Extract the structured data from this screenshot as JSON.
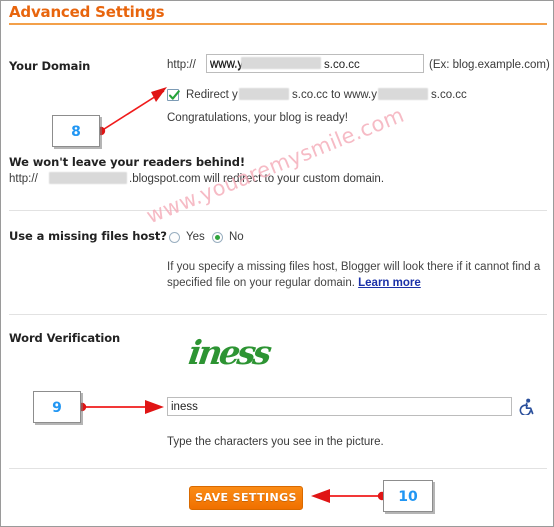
{
  "header": {
    "title": "Advanced Settings"
  },
  "domain": {
    "label": "Your Domain",
    "protocol_prefix": "http://",
    "input_value_start": "www.y",
    "input_value_end": "s.co.cc",
    "input_value_full": "www.y         s.co.cc",
    "example_hint": "(Ex: blog.example.com)",
    "redirect_checkbox_checked": true,
    "redirect_text_1": "Redirect y",
    "redirect_text_2": "s.co.cc to www.y",
    "redirect_text_3": "s.co.cc",
    "congratulations": "Congratulations, your blog is ready!",
    "readers_heading": "We won't leave your readers behind!",
    "readers_text_prefix": "http://",
    "readers_text_suffix": ".blogspot.com will redirect to your custom domain."
  },
  "missing_files": {
    "label": "Use a missing files host?",
    "option_yes": "Yes",
    "option_no": "No",
    "selected": "No",
    "description_line1": "If you specify a missing files host, Blogger will look there if it cannot find a",
    "description_line2": "specified file on your regular domain.",
    "learn_more": "Learn more"
  },
  "word_verification": {
    "label": "Word Verification",
    "captcha_text": "iness",
    "input_value": "iness",
    "instruction": "Type the characters you see in the picture.",
    "accessibility_icon": "wheelchair-icon"
  },
  "footer": {
    "save_label": "SAVE SETTINGS"
  },
  "annotations": [
    {
      "number": "8",
      "target": "redirect-checkbox"
    },
    {
      "number": "9",
      "target": "word-verification-input"
    },
    {
      "number": "10",
      "target": "save-settings-button"
    }
  ],
  "watermark": {
    "text": "www.youaremysmile.com"
  },
  "colors": {
    "accent_orange": "#e8650d",
    "rule_orange": "#f3a04a",
    "callout_blue": "#2196f3",
    "annotation_red": "#f01b1b",
    "captcha_green": "#2d9433",
    "link_blue": "#1b31a8",
    "watermark_pink": "#f4a8b6"
  }
}
